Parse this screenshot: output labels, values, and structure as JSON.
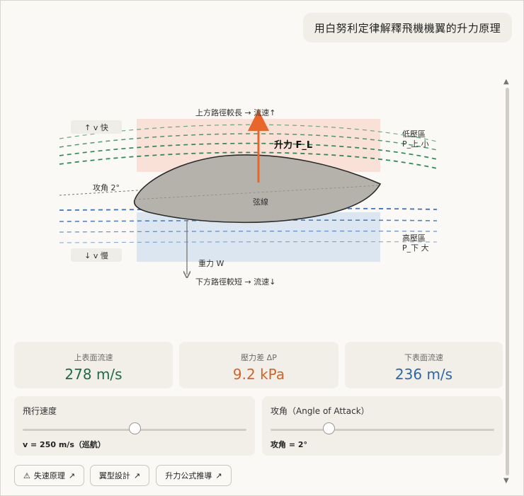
{
  "user_message": "用白努利定律解釋飛機機翼的升力原理",
  "diagram": {
    "top_path_label": "上方路徑較長 → 流速↑",
    "bottom_path_label": "下方路徑較短 → 流速↓",
    "v_fast_label": "↑ v 快",
    "v_slow_label": "↓ v 慢",
    "low_pressure_label": "低壓區",
    "low_pressure_sub": "P_上 小",
    "high_pressure_label": "高壓區",
    "high_pressure_sub": "P_下 大",
    "lift_label": "升力 F_L",
    "gravity_label": "重力 W",
    "angle_label": "攻角 2°",
    "chord_label": "弦線",
    "colors": {
      "low_pressure_fill": "#f9e1d8",
      "high_pressure_fill": "#dbe6f1",
      "top_stream": "#2e8b57",
      "bottom_stream": "#3f73b8",
      "lift_arrow": "#e8652b",
      "airfoil_fill": "#b4b2ab"
    }
  },
  "metrics": [
    {
      "label": "上表面流速",
      "value": "278 m/s",
      "color": "#1f6b48"
    },
    {
      "label": "壓力差 ΔP",
      "value": "9.2 kPa",
      "color": "#d2642a"
    },
    {
      "label": "下表面流速",
      "value": "236 m/s",
      "color": "#2d66a8"
    }
  ],
  "controls": {
    "speed": {
      "title": "飛行速度",
      "readout": "v = 250 m/s（巡航）",
      "level": 0.5
    },
    "angle": {
      "title": "攻角（Angle of Attack）",
      "readout": "攻角 = 2°",
      "level": 0.27
    }
  },
  "buttons": [
    {
      "label": "失速原理",
      "prefix": "⚠",
      "suffix": "↗"
    },
    {
      "label": "翼型設計",
      "suffix": "↗"
    },
    {
      "label": "升力公式推導",
      "suffix": "↗"
    }
  ]
}
